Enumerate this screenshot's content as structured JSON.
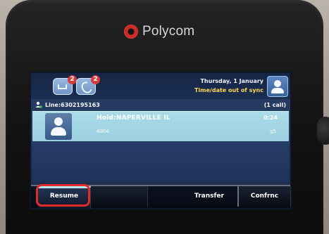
{
  "brand": {
    "name": "Polycom",
    "accent": "#e24a4a"
  },
  "status_bar": {
    "messages_badge": "2",
    "missed_calls_badge": "2",
    "date": "Thursday, 1 January",
    "sync_warning": "Time/date out of sync"
  },
  "line": {
    "label": "Line:6302195163",
    "call_count": "(1 call)"
  },
  "call": {
    "state_name": "Hold:NAPERVILLE  IL",
    "number": "4004",
    "duration": "0:24",
    "hd": "g5"
  },
  "softkeys": {
    "resume": "Resume",
    "transfer": "Transfer",
    "confrnc": "Confrnc"
  },
  "icons": [
    "messages-icon",
    "missed-calls-icon",
    "user-icon",
    "line-icon",
    "caller-avatar-icon",
    "polycom-logo-icon"
  ],
  "colors": {
    "highlight": "#e12a2a",
    "screen": "#213456",
    "call_row": "#a9dbe8",
    "sync_warning": "#ffd84d"
  }
}
